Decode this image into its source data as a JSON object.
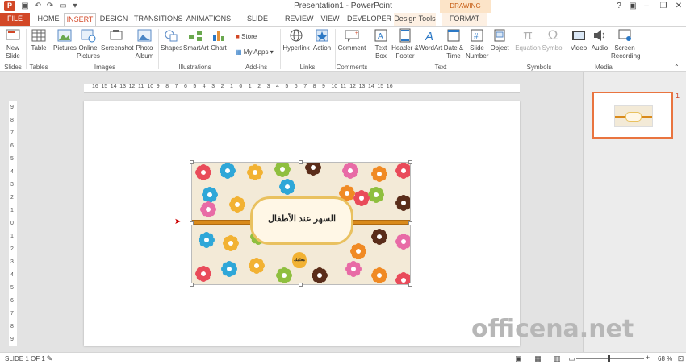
{
  "window": {
    "title": "Presentation1 - PowerPoint",
    "contextual_group": "DRAWING TOOLS",
    "app_icon_letter": "P"
  },
  "tabs": [
    {
      "label": "FILE"
    },
    {
      "label": "HOME"
    },
    {
      "label": "INSERT"
    },
    {
      "label": "DESIGN"
    },
    {
      "label": "TRANSITIONS"
    },
    {
      "label": "ANIMATIONS"
    },
    {
      "label": "SLIDE SHOW"
    },
    {
      "label": "REVIEW"
    },
    {
      "label": "VIEW"
    },
    {
      "label": "DEVELOPER"
    },
    {
      "label": "Design Tools"
    },
    {
      "label": "FORMAT"
    }
  ],
  "active_tab": "INSERT",
  "ribbon": {
    "new_slide": "New Slide",
    "table": "Table",
    "pictures": "Pictures",
    "online_pictures": "Online Pictures",
    "screenshot": "Screenshot",
    "photo_album": "Photo Album",
    "shapes": "Shapes",
    "smartart": "SmartArt",
    "chart": "Chart",
    "store": "Store",
    "my_apps": "My Apps",
    "hyperlink": "Hyperlink",
    "action": "Action",
    "comment": "Comment",
    "text_box": "Text Box",
    "header_footer": "Header & Footer",
    "wordart": "WordArt",
    "date_time": "Date & Time",
    "slide_number": "Slide Number",
    "object": "Object",
    "equation": "Equation",
    "symbol": "Symbol",
    "video": "Video",
    "audio": "Audio",
    "screen_recording": "Screen Recording",
    "groups": {
      "slides": "Slides",
      "tables": "Tables",
      "images": "Images",
      "illustrations": "Illustrations",
      "addins": "Add-ins",
      "links": "Links",
      "comments": "Comments",
      "text": "Text",
      "symbols": "Symbols",
      "media": "Media"
    }
  },
  "ruler": {
    "h_ticks": [
      "16",
      "15",
      "14",
      "13",
      "12",
      "11",
      "10",
      "9",
      "8",
      "7",
      "6",
      "5",
      "4",
      "3",
      "2",
      "1",
      "0",
      "1",
      "2",
      "3",
      "4",
      "5",
      "6",
      "7",
      "8",
      "9",
      "10",
      "11",
      "12",
      "13",
      "14",
      "15",
      "16"
    ],
    "v_ticks": [
      "9",
      "8",
      "7",
      "6",
      "5",
      "4",
      "3",
      "2",
      "1",
      "0",
      "1",
      "2",
      "3",
      "4",
      "5",
      "6",
      "7",
      "8",
      "9"
    ]
  },
  "slide": {
    "title_text": "السهر عند الأطفال",
    "badge_text": "معلمك"
  },
  "thumbnails": [
    {
      "number": "1"
    }
  ],
  "status": {
    "slide_info": "SLIDE 1 OF 1",
    "zoom": "68 %"
  },
  "watermark": "officena.net",
  "colors": {
    "accent": "#D24726",
    "ribbon_bg": "#FFFFFF",
    "workspace": "#E3E3E3",
    "banner_border": "#E9C15F",
    "stripe": "#D98A1B"
  }
}
